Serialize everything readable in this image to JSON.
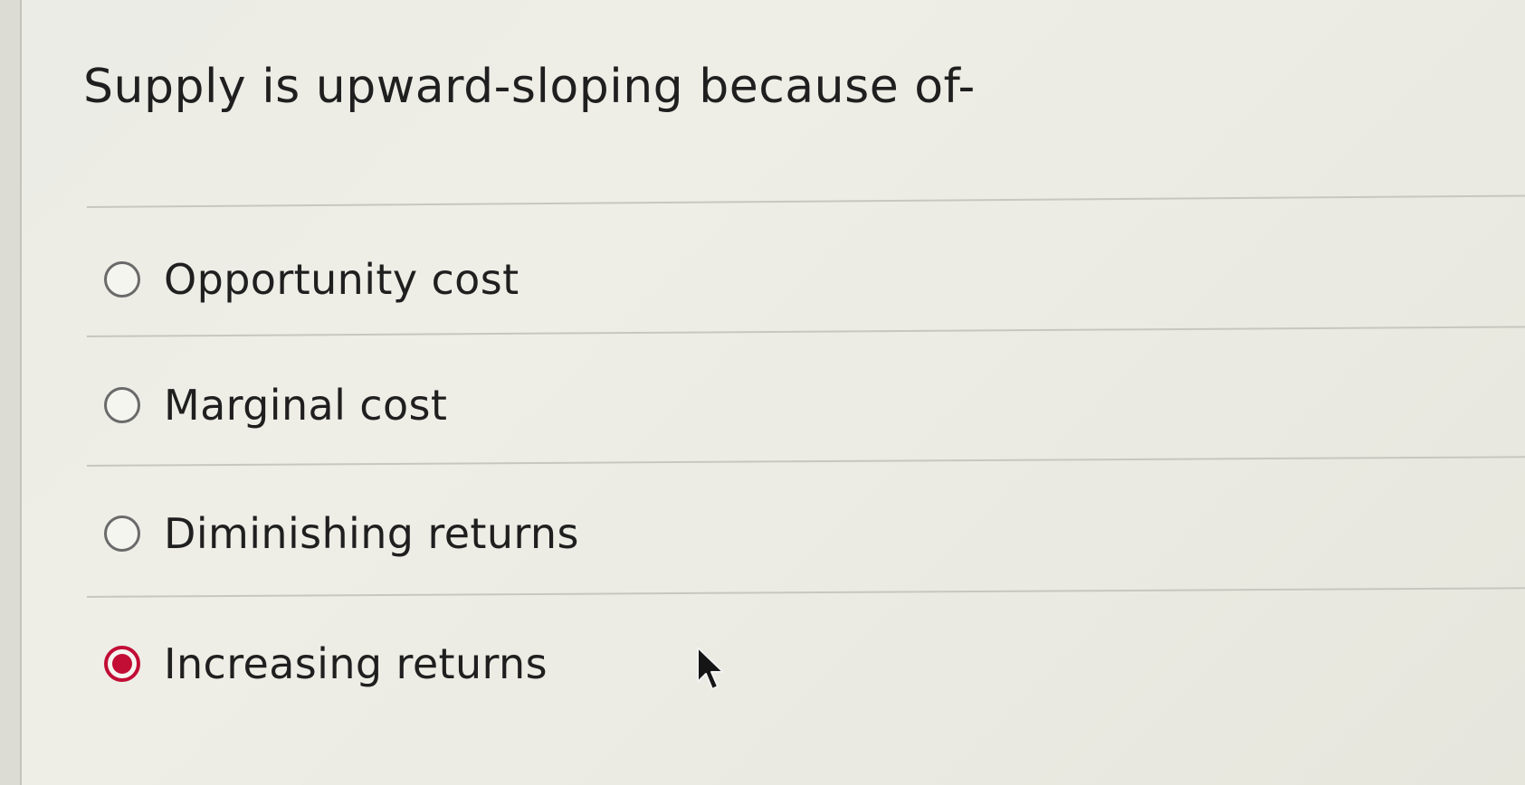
{
  "question": {
    "text": "Supply is upward-sloping because of-"
  },
  "options": [
    {
      "label": "Opportunity cost",
      "selected": false
    },
    {
      "label": "Marginal cost",
      "selected": false
    },
    {
      "label": "Diminishing returns",
      "selected": false
    },
    {
      "label": "Increasing returns",
      "selected": true
    }
  ],
  "colors": {
    "selected_accent": "#c20d35",
    "radio_border": "#6a6a6a",
    "divider": "#c7c7bf",
    "text": "#1f1f1f"
  }
}
